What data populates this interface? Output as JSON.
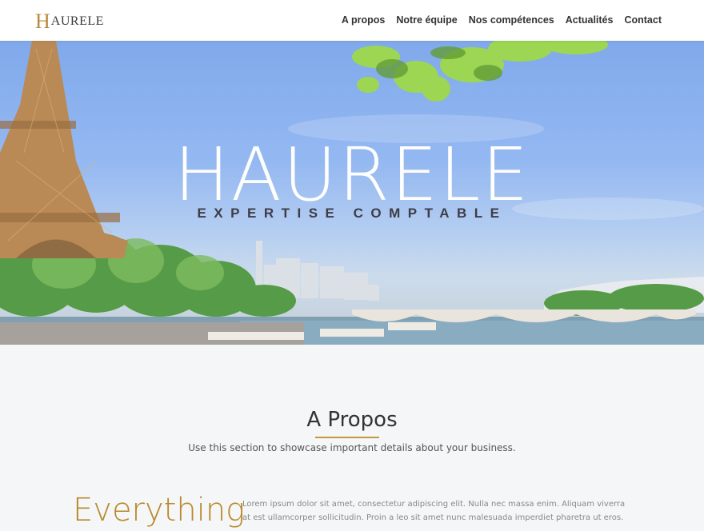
{
  "nav": {
    "logo_initial": "H",
    "logo_rest": "AURELE",
    "items": [
      "A propos",
      "Notre équipe",
      "Nos compétences",
      "Actualités",
      "Contact"
    ]
  },
  "hero": {
    "title": "HAURELE",
    "subtitle": "EXPERTISE COMPTABLE"
  },
  "about": {
    "title": "A Propos",
    "subtitle": "Use this section to showcase important details about your business.",
    "big_word": "Everything",
    "body": "Lorem ipsum dolor sit amet, consectetur adipiscing elit. Nulla nec massa enim. Aliquam viverra at est ullamcorper sollicitudin. Proin a leo sit amet nunc malesuada imperdiet pharetra ut eros."
  },
  "colors": {
    "accent": "#c49a3c",
    "text": "#333333"
  }
}
